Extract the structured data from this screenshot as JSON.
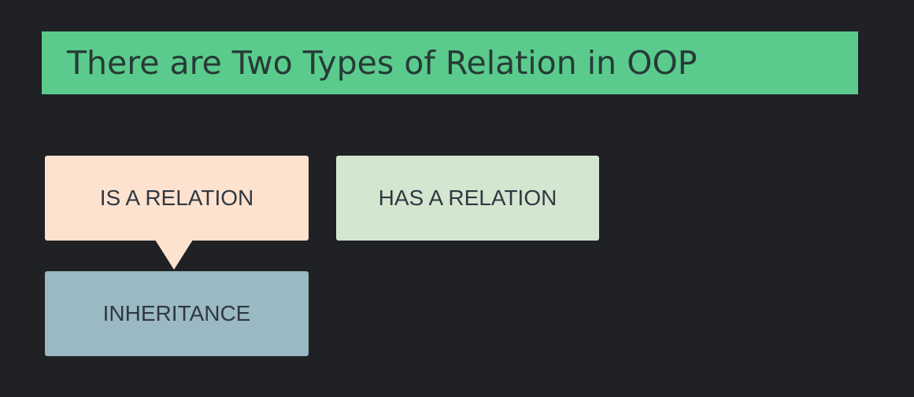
{
  "title": "There are Two Types of Relation in OOP",
  "boxes": {
    "is_a": "IS A RELATION",
    "has_a": "HAS A RELATION",
    "inheritance": "INHERITANCE"
  },
  "colors": {
    "background": "#1f2124",
    "title_bar": "#5acb8c",
    "is_a_box": "#fde2cf",
    "has_a_box": "#d3e6d0",
    "inheritance_box": "#9ab9c2",
    "text": "#303841"
  }
}
